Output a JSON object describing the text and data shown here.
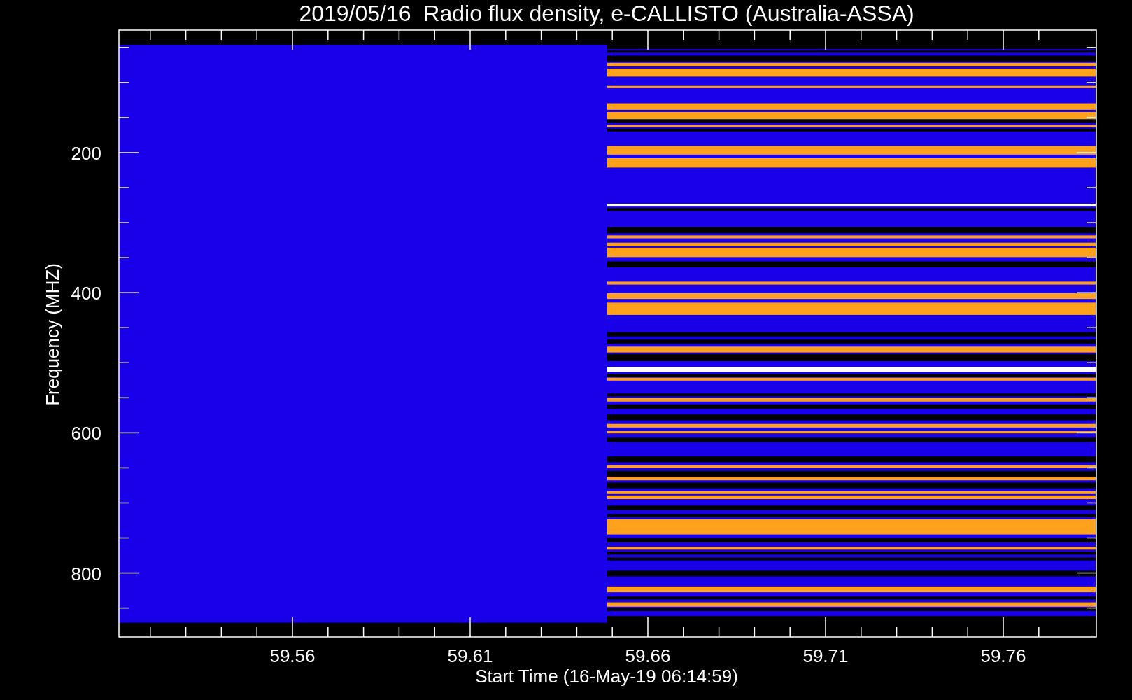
{
  "title": "2019/05/16  Radio flux density, e-CALLISTO (Australia-ASSA)",
  "y_axis": {
    "label": "Frequency (MHZ)",
    "ticks": [
      "200",
      "400",
      "600",
      "800"
    ]
  },
  "x_axis": {
    "label": "Start Time (16-May-19 06:14:59)",
    "ticks": [
      "59.56",
      "59.61",
      "59.66",
      "59.71",
      "59.76"
    ]
  }
}
